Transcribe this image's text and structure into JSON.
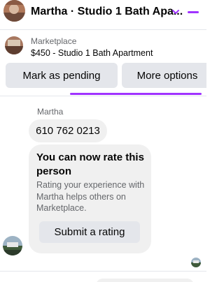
{
  "header": {
    "title": "Martha · Studio 1 Bath Apa...",
    "chevron_icon": "chevron-down-icon",
    "accent": "#a033ff"
  },
  "listing": {
    "kicker": "Marketplace",
    "title": "$450 - Studio 1 Bath Apartment",
    "actions": {
      "pending_label": "Mark as pending",
      "more_label": "More options"
    }
  },
  "conversation": {
    "sender_name": "Martha",
    "phone_message": "610 762 0213",
    "rating_card": {
      "title": "You can now rate this person",
      "body": "Rating your experience with Martha helps others on Marketplace.",
      "button_label": "Submit a rating"
    }
  },
  "colors": {
    "bubble_bg": "#f0f0f0",
    "button_bg": "#e4e6eb",
    "secondary_text": "#65676b",
    "accent": "#a033ff"
  }
}
